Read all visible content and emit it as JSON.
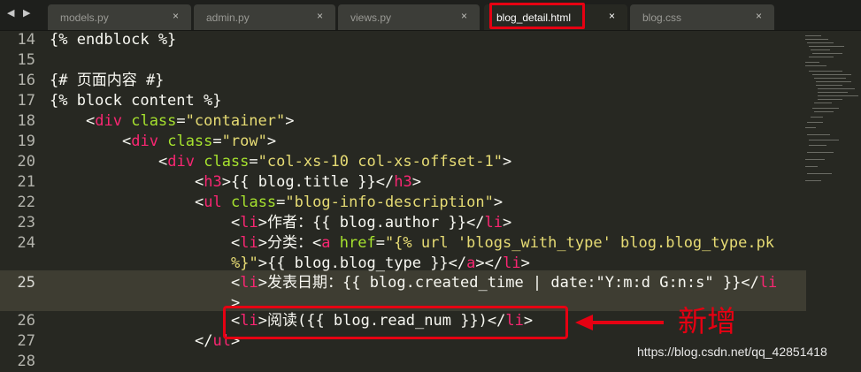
{
  "nav_arrows": "◀ ▶",
  "tabs": [
    {
      "label": "models.py",
      "close": "×",
      "active": false
    },
    {
      "label": "admin.py",
      "close": "×",
      "active": false
    },
    {
      "label": "views.py",
      "close": "×",
      "active": false
    },
    {
      "label": "blog_detail.html",
      "close": "×",
      "active": true
    },
    {
      "label": "blog.css",
      "close": "×",
      "active": false
    }
  ],
  "line_numbers": [
    "14",
    "15",
    "16",
    "17",
    "18",
    "19",
    "20",
    "21",
    "22",
    "23",
    "24",
    "",
    "25",
    "",
    "26",
    "27",
    "28"
  ],
  "code": {
    "l14": "{% endblock %}",
    "l16": "{# 页面内容 #}",
    "l17": "{% block content %}",
    "l18": {
      "lt": "<",
      "tag": "div",
      "attr": "class",
      "eq": "=",
      "val": "\"container\"",
      "gt": ">"
    },
    "l19": {
      "lt": "<",
      "tag": "div",
      "attr": "class",
      "eq": "=",
      "val": "\"row\"",
      "gt": ">"
    },
    "l20": {
      "lt": "<",
      "tag": "div",
      "attr": "class",
      "eq": "=",
      "val": "\"col-xs-10 col-xs-offset-1\"",
      "gt": ">"
    },
    "l21": {
      "lt": "<",
      "tag": "h3",
      "gt": ">",
      "text": "{{ blog.title }}",
      "clt": "</",
      "ctag": "h3",
      "cgt": ">"
    },
    "l22": {
      "lt": "<",
      "tag": "ul",
      "attr": "class",
      "eq": "=",
      "val": "\"blog-info-description\"",
      "gt": ">"
    },
    "l23": {
      "lt": "<",
      "tag": "li",
      "gt": ">",
      "text": "作者：{{ blog.author }}",
      "clt": "</",
      "ctag": "li",
      "cgt": ">"
    },
    "l24a": {
      "lt": "<",
      "tag": "li",
      "gt": ">",
      "text": "分类：",
      "alt": "<",
      "atag": "a",
      "attr": "href",
      "eq": "=",
      "val": "\"{% url 'blogs_with_type' blog.blog_type.pk"
    },
    "l24b": {
      "val": "%}\"",
      "gt": ">",
      "text": "{{ blog.blog_type }}",
      "clt": "</",
      "ctag": "a",
      "cgt": "></",
      "ctag2": "li",
      "cgt2": ">"
    },
    "l25a": {
      "lt": "<",
      "tag": "li",
      "gt": ">",
      "text": "发表日期：{{ blog.created_time | date:\"Y:m:d G:n:s\" }}",
      "clt": "</",
      "ctag": "li"
    },
    "l25b": ">",
    "l26": {
      "lt": "<",
      "tag": "li",
      "gt": ">",
      "text": "阅读({{ blog.read_num }})",
      "clt": "</",
      "ctag": "li",
      "cgt": ">"
    },
    "l27": {
      "clt": "</",
      "ctag": "ul",
      "cgt": ">"
    }
  },
  "annotation": {
    "label": "新增"
  },
  "watermark": "https://blog.csdn.net/qq_42851418",
  "colors": {
    "background": "#272822",
    "tag": "#f92672",
    "attr": "#a6e22e",
    "string": "#e6db74",
    "text": "#f8f8f2",
    "highlight": "#e60012"
  }
}
